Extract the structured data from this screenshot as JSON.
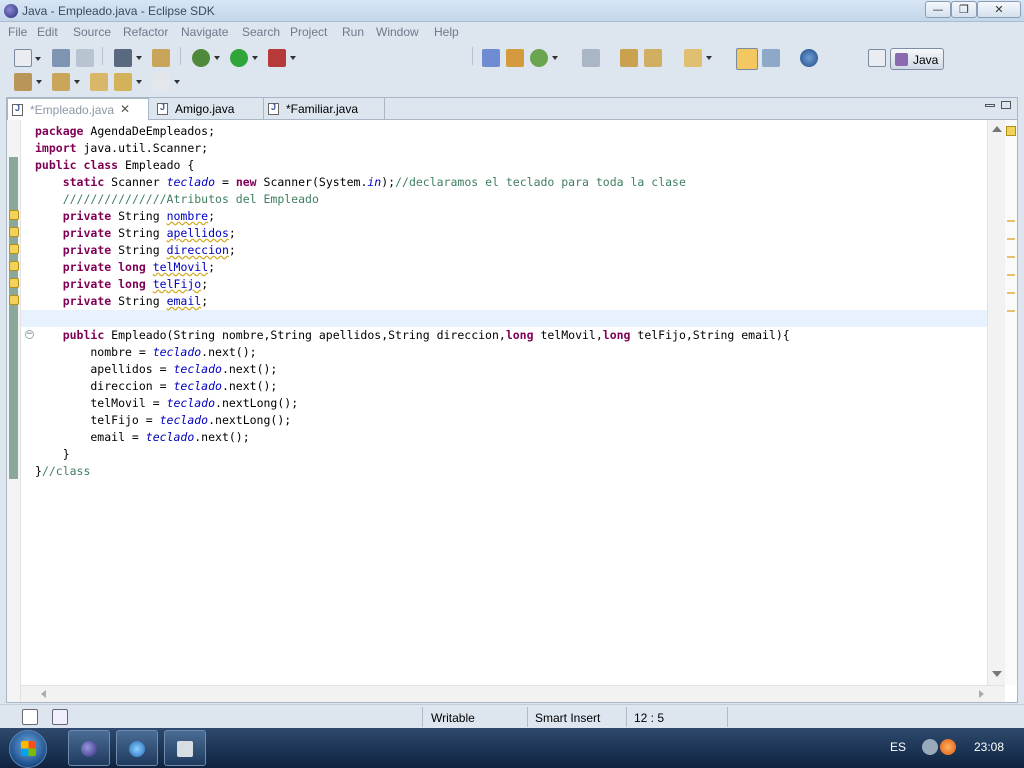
{
  "window": {
    "title": "Java - Empleado.java - Eclipse SDK",
    "controls": [
      "0",
      "1",
      "r"
    ]
  },
  "menu": [
    "File",
    "Edit",
    "Source",
    "Refactor",
    "Navigate",
    "Search",
    "Project",
    "Run",
    "Window",
    "Help"
  ],
  "perspective": {
    "label": "Java"
  },
  "tabs": [
    {
      "label": "*Empleado.java",
      "active": true
    },
    {
      "label": "Amigo.java",
      "active": false
    },
    {
      "label": "*Familiar.java",
      "active": false
    }
  ],
  "code_lines": [
    [
      {
        "t": "package",
        "c": "kw"
      },
      {
        "t": " AgendaDeEmpleados;"
      }
    ],
    [
      {
        "t": "import",
        "c": "kw"
      },
      {
        "t": " java.util.Scanner;"
      }
    ],
    [
      {
        "t": "public",
        "c": "kw"
      },
      {
        "t": " "
      },
      {
        "t": "class",
        "c": "kw"
      },
      {
        "t": " Empleado {"
      }
    ],
    [
      {
        "t": "    "
      },
      {
        "t": "static",
        "c": "kw"
      },
      {
        "t": " Scanner "
      },
      {
        "t": "teclado",
        "c": "fld"
      },
      {
        "t": " = "
      },
      {
        "t": "new",
        "c": "kw"
      },
      {
        "t": " Scanner(System."
      },
      {
        "t": "in",
        "c": "fld"
      },
      {
        "t": ");"
      },
      {
        "t": "//declaramos el teclado para toda la clase",
        "c": "cm"
      }
    ],
    [
      {
        "t": "    "
      },
      {
        "t": "///////////////Atributos del Empleado",
        "c": "cm"
      }
    ],
    [
      {
        "t": "    "
      },
      {
        "t": "private",
        "c": "kw"
      },
      {
        "t": " String "
      },
      {
        "t": "nombre",
        "c": "fn sq"
      },
      {
        "t": ";"
      }
    ],
    [
      {
        "t": "    "
      },
      {
        "t": "private",
        "c": "kw"
      },
      {
        "t": " String "
      },
      {
        "t": "apellidos",
        "c": "fn sq"
      },
      {
        "t": ";"
      }
    ],
    [
      {
        "t": "    "
      },
      {
        "t": "private",
        "c": "kw"
      },
      {
        "t": " String "
      },
      {
        "t": "direccion",
        "c": "fn sq"
      },
      {
        "t": ";"
      }
    ],
    [
      {
        "t": "    "
      },
      {
        "t": "private",
        "c": "kw"
      },
      {
        "t": " "
      },
      {
        "t": "long",
        "c": "kw"
      },
      {
        "t": " "
      },
      {
        "t": "telMovil",
        "c": "fn sq"
      },
      {
        "t": ";"
      }
    ],
    [
      {
        "t": "    "
      },
      {
        "t": "private",
        "c": "kw"
      },
      {
        "t": " "
      },
      {
        "t": "long",
        "c": "kw"
      },
      {
        "t": " "
      },
      {
        "t": "telFijo",
        "c": "fn sq"
      },
      {
        "t": ";"
      }
    ],
    [
      {
        "t": "    "
      },
      {
        "t": "private",
        "c": "kw"
      },
      {
        "t": " String "
      },
      {
        "t": "email",
        "c": "fn sq"
      },
      {
        "t": ";"
      }
    ],
    [
      {
        "t": ""
      }
    ],
    [
      {
        "t": "    "
      },
      {
        "t": "public",
        "c": "kw"
      },
      {
        "t": " Empleado(String nombre,String apellidos,String direccion,"
      },
      {
        "t": "long",
        "c": "kw"
      },
      {
        "t": " telMovil,"
      },
      {
        "t": "long",
        "c": "kw"
      },
      {
        "t": " telFijo,String email){"
      }
    ],
    [
      {
        "t": "        nombre = "
      },
      {
        "t": "teclado",
        "c": "fld"
      },
      {
        "t": ".next();"
      }
    ],
    [
      {
        "t": "        apellidos = "
      },
      {
        "t": "teclado",
        "c": "fld"
      },
      {
        "t": ".next();"
      }
    ],
    [
      {
        "t": "        direccion = "
      },
      {
        "t": "teclado",
        "c": "fld"
      },
      {
        "t": ".next();"
      }
    ],
    [
      {
        "t": "        telMovil = "
      },
      {
        "t": "teclado",
        "c": "fld"
      },
      {
        "t": ".nextLong();"
      }
    ],
    [
      {
        "t": "        telFijo = "
      },
      {
        "t": "teclado",
        "c": "fld"
      },
      {
        "t": ".nextLong();"
      }
    ],
    [
      {
        "t": "        email = "
      },
      {
        "t": "teclado",
        "c": "fld"
      },
      {
        "t": ".next();"
      }
    ],
    [
      {
        "t": "    }"
      }
    ],
    [
      {
        "t": "}"
      },
      {
        "t": "//class",
        "c": "cm"
      }
    ]
  ],
  "current_line_index": 11,
  "statusbar": {
    "mode": "Writable",
    "insert": "Smart Insert",
    "position": "12 : 5"
  },
  "taskbar": {
    "language": "ES",
    "clock": "23:08"
  }
}
